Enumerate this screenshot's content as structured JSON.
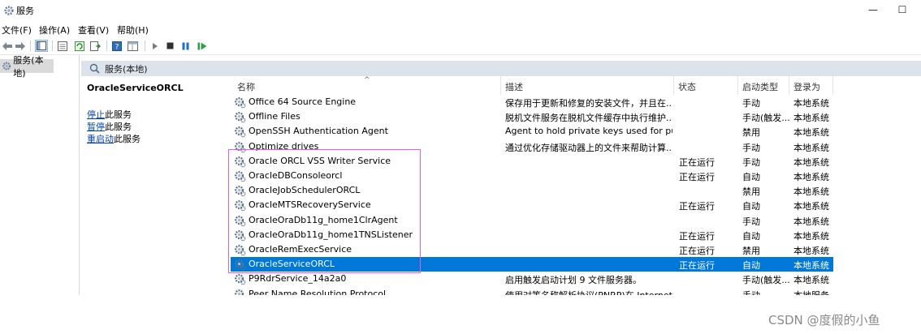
{
  "window": {
    "title": "服务",
    "minimize": "—",
    "maximize": "☐"
  },
  "menu": [
    "文件(F)",
    "操作(A)",
    "查看(V)",
    "帮助(H)"
  ],
  "toolbar_icons": [
    "back-arrow-icon",
    "forward-arrow-icon",
    "console-tree-icon",
    "properties-icon",
    "refresh-icon",
    "export-list-icon",
    "help-icon",
    "view-icon",
    "start-service-icon",
    "stop-service-icon",
    "pause-service-icon",
    "resume-service-icon"
  ],
  "tree": {
    "root": "服务(本地)"
  },
  "panel": {
    "header": "服务(本地)"
  },
  "detail": {
    "service_name": "OracleServiceORCL",
    "actions": [
      {
        "link": "停止",
        "rest": "此服务"
      },
      {
        "link": "暂停",
        "rest": "此服务"
      },
      {
        "link": "重启动",
        "rest": "此服务"
      }
    ]
  },
  "columns": {
    "name": "名称",
    "desc": "描述",
    "status": "状态",
    "startup": "启动类型",
    "logon": "登录为"
  },
  "rows": [
    {
      "name": "Office 64 Source Engine",
      "desc": "保存用于更新和修复的安装文件，并且在...",
      "status": "",
      "startup": "手动",
      "logon": "本地系统"
    },
    {
      "name": "Offline Files",
      "desc": "脱机文件服务在脱机文件缓存中执行维护...",
      "status": "",
      "startup": "手动(触发...",
      "logon": "本地系统"
    },
    {
      "name": "OpenSSH Authentication Agent",
      "desc": "Agent to hold private keys used for pu...",
      "status": "",
      "startup": "禁用",
      "logon": "本地系统"
    },
    {
      "name": "Optimize drives",
      "desc": "通过优化存储驱动器上的文件来帮助计算...",
      "status": "",
      "startup": "手动",
      "logon": "本地系统"
    },
    {
      "name": "Oracle ORCL VSS Writer Service",
      "desc": "",
      "status": "正在运行",
      "startup": "手动",
      "logon": "本地系统"
    },
    {
      "name": "OracleDBConsoleorcl",
      "desc": "",
      "status": "正在运行",
      "startup": "自动",
      "logon": "本地系统"
    },
    {
      "name": "OracleJobSchedulerORCL",
      "desc": "",
      "status": "",
      "startup": "禁用",
      "logon": "本地系统"
    },
    {
      "name": "OracleMTSRecoveryService",
      "desc": "",
      "status": "正在运行",
      "startup": "自动",
      "logon": "本地系统"
    },
    {
      "name": "OracleOraDb11g_home1ClrAgent",
      "desc": "",
      "status": "",
      "startup": "手动",
      "logon": "本地系统"
    },
    {
      "name": "OracleOraDb11g_home1TNSListener",
      "desc": "",
      "status": "正在运行",
      "startup": "自动",
      "logon": "本地系统"
    },
    {
      "name": "OracleRemExecService",
      "desc": "",
      "status": "正在运行",
      "startup": "禁用",
      "logon": "本地系统"
    },
    {
      "name": "OracleServiceORCL",
      "desc": "",
      "status": "正在运行",
      "startup": "自动",
      "logon": "本地系统",
      "selected": true
    },
    {
      "name": "P9RdrService_14a2a0",
      "desc": "启用触发启动计划 9 文件服务器。",
      "status": "",
      "startup": "手动(触发...",
      "logon": "本地系统"
    },
    {
      "name": "Peer Name Resolution Protocol",
      "desc": "使用对等名称解析协议(PNRP)在 Internet...",
      "status": "",
      "startup": "手动",
      "logon": "本地服务"
    }
  ],
  "colors": {
    "selection": "#0078d7",
    "annotation_box": "#e15de1",
    "link": "#0645ad"
  },
  "watermark": "CSDN @度假的小鱼"
}
